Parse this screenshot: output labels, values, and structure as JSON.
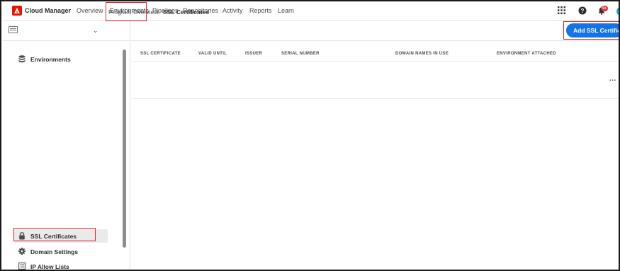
{
  "app": {
    "name": "Cloud Manager",
    "logo": "adobe-logo"
  },
  "nav": {
    "items": [
      {
        "label": "Overview"
      },
      {
        "label": "Environments"
      },
      {
        "label": "Pipelines"
      },
      {
        "label": "Repositories"
      },
      {
        "label": "Activity"
      },
      {
        "label": "Reports"
      },
      {
        "label": "Learn"
      }
    ],
    "active": "Environments",
    "notification_badge": "9+"
  },
  "sidebar": {
    "items": [
      {
        "label": "Environments",
        "icon": "database-icon"
      },
      {
        "label": "SSL Certificates",
        "icon": "lock-icon"
      },
      {
        "label": "Domain Settings",
        "icon": "gear-icon"
      },
      {
        "label": "IP Allow Lists",
        "icon": "list-icon"
      }
    ],
    "selected": "SSL Certificates"
  },
  "breadcrumb": {
    "parent": "Program Overview",
    "separator": ">",
    "current": "SSL Certificates"
  },
  "toolbar": {
    "add_label": "Add SSL Certificate"
  },
  "table": {
    "columns": [
      "SSL CERTIFICATE",
      "VALID UNTIL",
      "ISSUER",
      "SERIAL NUMBER",
      "DOMAIN NAMES IN USE",
      "ENVIRONMENT ATTACHED"
    ],
    "row_menu": "..."
  },
  "colors": {
    "accent": "#1473e6",
    "brand": "#eb1000",
    "highlight": "#d9252b"
  }
}
